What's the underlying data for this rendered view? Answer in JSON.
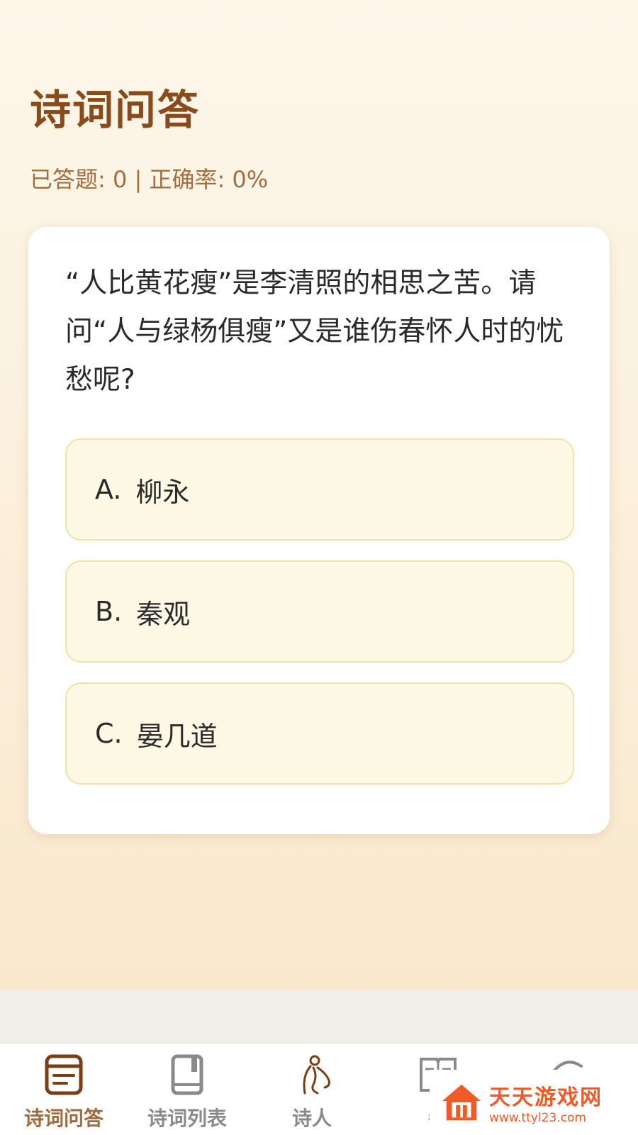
{
  "header": {
    "title": "诗词问答",
    "stats": "已答题: 0 | 正确率: 0%"
  },
  "question": {
    "text": "“人比黄花瘦”是李清照的相思之苦。请问“人与绿杨俱瘦”又是谁伤春怀人时的忧愁呢?"
  },
  "options": [
    {
      "letter": "A.",
      "text": "柳永"
    },
    {
      "letter": "B.",
      "text": "秦观"
    },
    {
      "letter": "C.",
      "text": "晏几道"
    }
  ],
  "tabs": [
    {
      "label": "诗词问答",
      "icon": "quiz-icon",
      "active": true
    },
    {
      "label": "诗词列表",
      "icon": "book-icon",
      "active": false
    },
    {
      "label": "诗人",
      "icon": "poet-icon",
      "active": false
    },
    {
      "label": "每",
      "icon": "daily-book-icon",
      "active": false
    },
    {
      "label": "",
      "icon": "more-icon",
      "active": false
    }
  ],
  "watermark": {
    "title": "天天游戏网",
    "url": "www.ttyl23.com"
  },
  "colors": {
    "accent": "#8a4b1c",
    "option_bg": "#fdf8e4",
    "option_border": "#f1e2a6",
    "watermark": "#f05a28"
  }
}
